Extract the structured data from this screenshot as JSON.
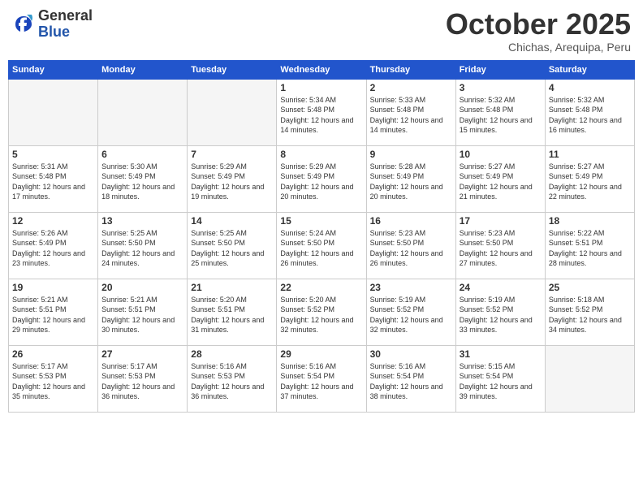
{
  "header": {
    "logo_general": "General",
    "logo_blue": "Blue",
    "month_title": "October 2025",
    "subtitle": "Chichas, Arequipa, Peru"
  },
  "days_of_week": [
    "Sunday",
    "Monday",
    "Tuesday",
    "Wednesday",
    "Thursday",
    "Friday",
    "Saturday"
  ],
  "weeks": [
    [
      {
        "day": "",
        "empty": true
      },
      {
        "day": "",
        "empty": true
      },
      {
        "day": "",
        "empty": true
      },
      {
        "day": "1",
        "sunrise": "5:34 AM",
        "sunset": "5:48 PM",
        "daylight": "12 hours and 14 minutes."
      },
      {
        "day": "2",
        "sunrise": "5:33 AM",
        "sunset": "5:48 PM",
        "daylight": "12 hours and 14 minutes."
      },
      {
        "day": "3",
        "sunrise": "5:32 AM",
        "sunset": "5:48 PM",
        "daylight": "12 hours and 15 minutes."
      },
      {
        "day": "4",
        "sunrise": "5:32 AM",
        "sunset": "5:48 PM",
        "daylight": "12 hours and 16 minutes."
      }
    ],
    [
      {
        "day": "5",
        "sunrise": "5:31 AM",
        "sunset": "5:48 PM",
        "daylight": "12 hours and 17 minutes."
      },
      {
        "day": "6",
        "sunrise": "5:30 AM",
        "sunset": "5:49 PM",
        "daylight": "12 hours and 18 minutes."
      },
      {
        "day": "7",
        "sunrise": "5:29 AM",
        "sunset": "5:49 PM",
        "daylight": "12 hours and 19 minutes."
      },
      {
        "day": "8",
        "sunrise": "5:29 AM",
        "sunset": "5:49 PM",
        "daylight": "12 hours and 20 minutes."
      },
      {
        "day": "9",
        "sunrise": "5:28 AM",
        "sunset": "5:49 PM",
        "daylight": "12 hours and 20 minutes."
      },
      {
        "day": "10",
        "sunrise": "5:27 AM",
        "sunset": "5:49 PM",
        "daylight": "12 hours and 21 minutes."
      },
      {
        "day": "11",
        "sunrise": "5:27 AM",
        "sunset": "5:49 PM",
        "daylight": "12 hours and 22 minutes."
      }
    ],
    [
      {
        "day": "12",
        "sunrise": "5:26 AM",
        "sunset": "5:49 PM",
        "daylight": "12 hours and 23 minutes."
      },
      {
        "day": "13",
        "sunrise": "5:25 AM",
        "sunset": "5:50 PM",
        "daylight": "12 hours and 24 minutes."
      },
      {
        "day": "14",
        "sunrise": "5:25 AM",
        "sunset": "5:50 PM",
        "daylight": "12 hours and 25 minutes."
      },
      {
        "day": "15",
        "sunrise": "5:24 AM",
        "sunset": "5:50 PM",
        "daylight": "12 hours and 26 minutes."
      },
      {
        "day": "16",
        "sunrise": "5:23 AM",
        "sunset": "5:50 PM",
        "daylight": "12 hours and 26 minutes."
      },
      {
        "day": "17",
        "sunrise": "5:23 AM",
        "sunset": "5:50 PM",
        "daylight": "12 hours and 27 minutes."
      },
      {
        "day": "18",
        "sunrise": "5:22 AM",
        "sunset": "5:51 PM",
        "daylight": "12 hours and 28 minutes."
      }
    ],
    [
      {
        "day": "19",
        "sunrise": "5:21 AM",
        "sunset": "5:51 PM",
        "daylight": "12 hours and 29 minutes."
      },
      {
        "day": "20",
        "sunrise": "5:21 AM",
        "sunset": "5:51 PM",
        "daylight": "12 hours and 30 minutes."
      },
      {
        "day": "21",
        "sunrise": "5:20 AM",
        "sunset": "5:51 PM",
        "daylight": "12 hours and 31 minutes."
      },
      {
        "day": "22",
        "sunrise": "5:20 AM",
        "sunset": "5:52 PM",
        "daylight": "12 hours and 32 minutes."
      },
      {
        "day": "23",
        "sunrise": "5:19 AM",
        "sunset": "5:52 PM",
        "daylight": "12 hours and 32 minutes."
      },
      {
        "day": "24",
        "sunrise": "5:19 AM",
        "sunset": "5:52 PM",
        "daylight": "12 hours and 33 minutes."
      },
      {
        "day": "25",
        "sunrise": "5:18 AM",
        "sunset": "5:52 PM",
        "daylight": "12 hours and 34 minutes."
      }
    ],
    [
      {
        "day": "26",
        "sunrise": "5:17 AM",
        "sunset": "5:53 PM",
        "daylight": "12 hours and 35 minutes."
      },
      {
        "day": "27",
        "sunrise": "5:17 AM",
        "sunset": "5:53 PM",
        "daylight": "12 hours and 36 minutes."
      },
      {
        "day": "28",
        "sunrise": "5:16 AM",
        "sunset": "5:53 PM",
        "daylight": "12 hours and 36 minutes."
      },
      {
        "day": "29",
        "sunrise": "5:16 AM",
        "sunset": "5:54 PM",
        "daylight": "12 hours and 37 minutes."
      },
      {
        "day": "30",
        "sunrise": "5:16 AM",
        "sunset": "5:54 PM",
        "daylight": "12 hours and 38 minutes."
      },
      {
        "day": "31",
        "sunrise": "5:15 AM",
        "sunset": "5:54 PM",
        "daylight": "12 hours and 39 minutes."
      },
      {
        "day": "",
        "empty": true
      }
    ]
  ]
}
